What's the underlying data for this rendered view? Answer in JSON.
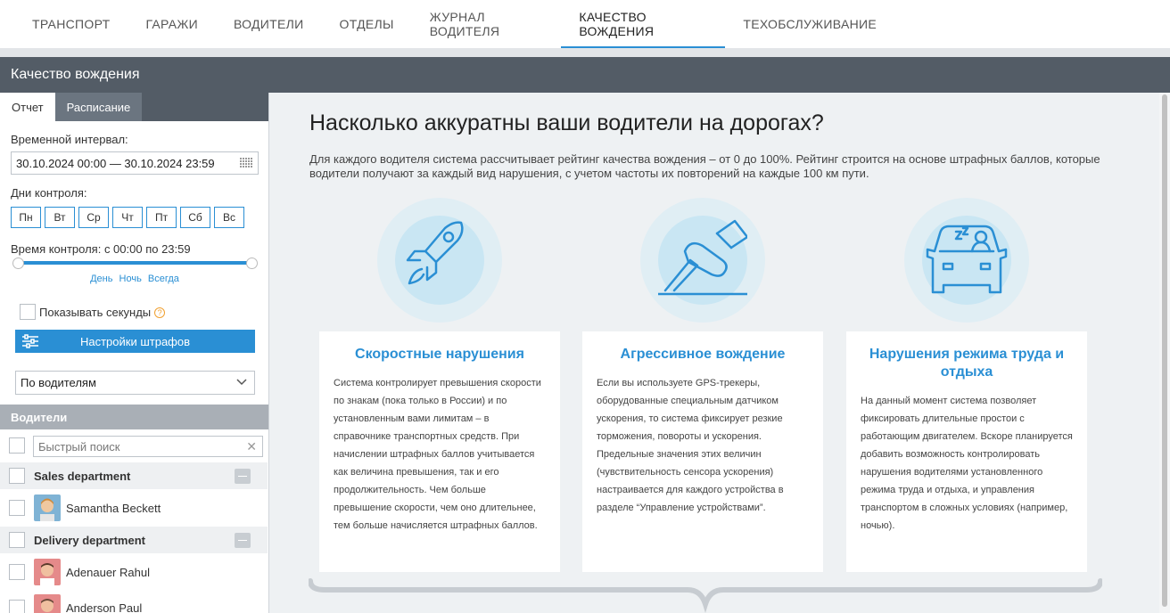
{
  "nav": {
    "tabs": [
      "ТРАНСПОРТ",
      "ГАРАЖИ",
      "ВОДИТЕЛИ",
      "ОТДЕЛЫ",
      "ЖУРНАЛ ВОДИТЕЛЯ",
      "КАЧЕСТВО ВОЖДЕНИЯ",
      "ТЕХОБСЛУЖИВАНИЕ"
    ],
    "active": "КАЧЕСТВО ВОЖДЕНИЯ"
  },
  "header": {
    "title": "Качество вождения"
  },
  "sidebar": {
    "tabs": [
      "Отчет",
      "Расписание"
    ],
    "interval_label": "Временной интервал:",
    "interval_value": "30.10.2024 00:00 — 30.10.2024 23:59",
    "days_label": "Дни контроля:",
    "days": [
      "Пн",
      "Вт",
      "Ср",
      "Чт",
      "Пт",
      "Сб",
      "Вс"
    ],
    "time_label": "Время контроля: с 00:00 по 23:59",
    "presets": [
      "День",
      "Ночь",
      "Всегда"
    ],
    "show_seconds_label": "Показывать секунды",
    "penalty_button": "Настройки штрафов",
    "group_by": "По водителям",
    "drivers_header": "Водители",
    "search_placeholder": "Быстрый поиск",
    "groups": [
      {
        "name": "Sales department",
        "drivers": [
          "Samantha Beckett"
        ]
      },
      {
        "name": "Delivery department",
        "drivers": [
          "Adenauer Rahul",
          "Anderson Paul"
        ]
      }
    ]
  },
  "main": {
    "headline": "Насколько аккуратны ваши водители на дорогах?",
    "intro": "Для каждого водителя система рассчитывает рейтинг качества вождения – от 0 до 100%. Рейтинг строится на основе штрафных баллов, которые водители получают за каждый вид нарушения, с учетом частоты их повторений на каждые 100 км пути.",
    "cards": [
      {
        "icon": "rocket-icon",
        "title": "Скоростные нарушения",
        "text": "Система контролирует превышения скорости по знакам (пока только в России) и по установленным вами лимитам – в справочнике транспортных средств. При начислении штрафных баллов учитывается как величина превышения, так и его продолжительность. Чем больше превышение скорости, чем оно длительнее, тем больше начисляется штрафных баллов."
      },
      {
        "icon": "pedal-icon",
        "title": "Агрессивное вождение",
        "text": "Если вы используете GPS-трекеры, оборудованные специальным датчиком ускорения, то система фиксирует резкие торможения, повороты и ускорения. Предельные значения этих величин (чувствительность сенсора ускорения) настраивается для каждого устройства в разделе “Управление устройствами”."
      },
      {
        "icon": "sleeping-driver-icon",
        "title": "Нарушения режима труда и отдыха",
        "text": "На данный момент система позволяет фиксировать длительные простои с работающим двигателем. Вскоре планируется добавить возможность контролировать нарушения водителями установленного режима труда и отдыха, и управления транспортом в сложных условиях (например, ночью)."
      }
    ]
  },
  "colors": {
    "accent": "#2a8fd4",
    "header": "#535c66"
  }
}
